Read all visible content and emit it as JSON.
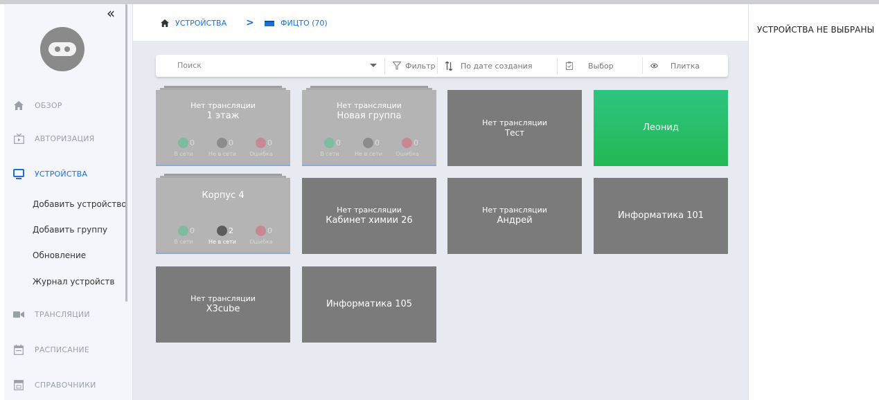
{
  "sidebar": {
    "collapse_label": "«",
    "nav": [
      {
        "label": "ОБЗОР",
        "icon": "home-icon"
      },
      {
        "label": "АВТОРИЗАЦИЯ",
        "icon": "tv-login-icon"
      },
      {
        "label": "УСТРОЙСТВА",
        "icon": "monitor-icon",
        "active": true
      },
      {
        "label": "ТРАНСЛЯЦИИ",
        "icon": "camera-icon"
      },
      {
        "label": "РАСПИСАНИЕ",
        "icon": "calendar-icon"
      },
      {
        "label": "СПРАВОЧНИКИ",
        "icon": "directory-icon"
      }
    ],
    "subitems": [
      "Добавить устройство",
      "Добавить группу",
      "Обновление",
      "Журнал устройств"
    ]
  },
  "breadcrumb": {
    "devices": "УСТРОЙСТВА",
    "separator": ">",
    "current": "ФИЦТО (70)"
  },
  "toolbar": {
    "search_placeholder": "Поиск",
    "filter": "Фильтр",
    "sort": "По дате создания",
    "select": "Выбор",
    "view": "Плитка"
  },
  "count_labels": {
    "online": "В сети",
    "offline": "Не в сети",
    "error": "Ошибка"
  },
  "tiles": [
    {
      "kind": "group",
      "status": "Нет трансляции",
      "name": "1 этаж",
      "online": "0",
      "offline": "0",
      "error": "0"
    },
    {
      "kind": "group",
      "status": "Нет трансляции",
      "name": "Новая группа",
      "online": "0",
      "offline": "0",
      "error": "0"
    },
    {
      "kind": "device",
      "status": "Нет трансляции",
      "name": "Тест"
    },
    {
      "kind": "online",
      "status": "",
      "name": "Леонид"
    },
    {
      "kind": "group",
      "status": "",
      "name": "Корпус 4",
      "online": "0",
      "offline": "2",
      "error": "0"
    },
    {
      "kind": "device",
      "status": "Нет трансляции",
      "name": "Кабинет химии 26"
    },
    {
      "kind": "device",
      "status": "Нет трансляции",
      "name": "Андрей"
    },
    {
      "kind": "device",
      "status": "",
      "name": "Информатика 101"
    },
    {
      "kind": "device",
      "status": "Нет трансляции",
      "name": "X3cube"
    },
    {
      "kind": "device",
      "status": "",
      "name": "Информатика 105"
    }
  ],
  "right_panel": {
    "message": "УСТРОЙСТВА НЕ ВЫБРАНЫ"
  },
  "colors": {
    "accent": "#1a6fd6",
    "tile_device": "#7b7b7b",
    "tile_group": "#b4b4b4",
    "tile_online": "#22b954",
    "status_online": "#3ec483",
    "status_offline": "#5c5c5c",
    "status_error": "#e0506a"
  }
}
